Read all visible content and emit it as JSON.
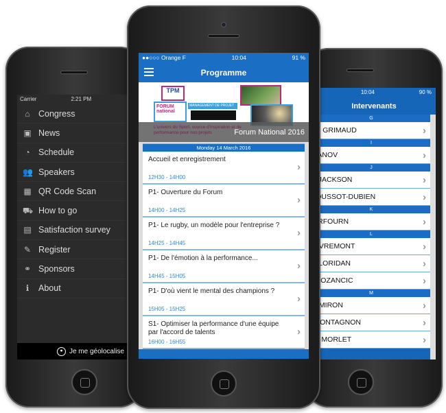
{
  "left_phone": {
    "status": {
      "carrier": "Carrier",
      "time": "2:21 PM"
    },
    "menu": [
      {
        "label": "Congress",
        "icon": "home-icon",
        "glyph": "⌂"
      },
      {
        "label": "News",
        "icon": "news-icon",
        "glyph": "▣"
      },
      {
        "label": "Schedule",
        "icon": "clock-icon",
        "glyph": "◔"
      },
      {
        "label": "Speakers",
        "icon": "people-icon",
        "glyph": "👥"
      },
      {
        "label": "QR Code Scan",
        "icon": "qr-code-icon",
        "glyph": "▦"
      },
      {
        "label": "How to go",
        "icon": "map-icon",
        "glyph": "⛟"
      },
      {
        "label": "Satisfaction survey",
        "icon": "clipboard-icon",
        "glyph": "▤"
      },
      {
        "label": "Register",
        "icon": "edit-icon",
        "glyph": "✎"
      },
      {
        "label": "Sponsors",
        "icon": "handshake-icon",
        "glyph": "⚭"
      },
      {
        "label": "About",
        "icon": "info-icon",
        "glyph": "ℹ"
      }
    ],
    "geolocate": "Je me géolocalise"
  },
  "center_phone": {
    "status": {
      "carrier": "●●○○○ Orange F",
      "time": "10:04",
      "battery": "91 %"
    },
    "title": "Programme",
    "banner": {
      "logo_text": "TPM",
      "forum": "FORUM national",
      "project": "MANAGEMENT DE PROJET",
      "tagline": "L'univers du Sport, source d'inspiration et de performance pour nos projets",
      "overlay_title": "Forum National 2016"
    },
    "day": "Monday 14 March 2016",
    "sessions": [
      {
        "title": "Accueil et enregistrement",
        "time": "12H30 - 14H00"
      },
      {
        "title": "P1- Ouverture du Forum",
        "time": "14H00 - 14H25"
      },
      {
        "title": "P1- Le rugby, un modèle pour l'entreprise ?",
        "time": "14H25 - 14H45"
      },
      {
        "title": "P1- De l'émotion à la performance...",
        "time": "14H45 - 15H05"
      },
      {
        "title": "P1- D'où vient le mental des champions ?",
        "time": "15H05 - 15H25"
      },
      {
        "title": "S1- Optimiser la performance d'une équipe par l'accord de talents",
        "time": "16H00 - 16H55"
      }
    ]
  },
  "right_phone": {
    "status": {
      "time": "10:04",
      "battery": "90 %"
    },
    "title": "Intervenants",
    "groups": [
      {
        "letter": "G",
        "names": [
          "abeth  GRIMAUD"
        ]
      },
      {
        "letter": "I",
        "names": [
          "er  IVANOV"
        ]
      },
      {
        "letter": "J",
        "names": [
          "anie  JACKSON",
          "es  JOUSSOT-DUBIEN"
        ]
      },
      {
        "letter": "K",
        "names": [
          "c  KERFOURN"
        ]
      },
      {
        "letter": "L",
        "names": [
          "c  LIEVREMONT",
          "ome  LORIDAN",
          "ana  LOZANCIC"
        ]
      },
      {
        "letter": "M",
        "names": [
          "hard  MIRON",
          "vie  MONTAGNON",
          "istine  MORLET"
        ]
      }
    ]
  },
  "colors": {
    "primary": "#1a6fc4",
    "time_text": "#2b8ad8",
    "menu_bg": "#2b2b2b"
  }
}
